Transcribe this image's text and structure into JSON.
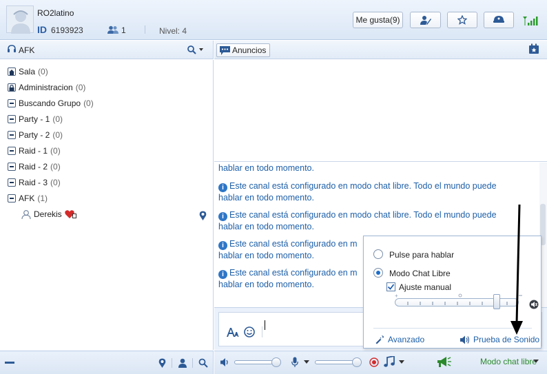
{
  "header": {
    "username": "RO2latino",
    "id_label": "ID",
    "id_value": "6193923",
    "friends_count": "1",
    "level": "Nivel: 4",
    "likes_button": "Me gusta(9)"
  },
  "left_panel": {
    "title": "AFK",
    "channels": [
      {
        "name": "Sala",
        "count": "(0)",
        "icon": "home-icon"
      },
      {
        "name": "Administracion",
        "count": "(0)",
        "icon": "lock-icon"
      },
      {
        "name": "Buscando Grupo",
        "count": "(0)",
        "icon": "collapse-icon"
      },
      {
        "name": "Party - 1",
        "count": "(0)",
        "icon": "collapse-icon"
      },
      {
        "name": "Party - 2",
        "count": "(0)",
        "icon": "collapse-icon"
      },
      {
        "name": "Raid - 1",
        "count": "(0)",
        "icon": "collapse-icon"
      },
      {
        "name": "Raid - 2",
        "count": "(0)",
        "icon": "collapse-icon"
      },
      {
        "name": "Raid - 3",
        "count": "(0)",
        "icon": "collapse-icon"
      },
      {
        "name": "AFK",
        "count": "(1)",
        "icon": "collapse-icon"
      }
    ],
    "user": "Derekis"
  },
  "right_panel": {
    "announce_button": "Anuncios",
    "partial_message": "hablar en todo momento.",
    "messages": [
      {
        "line1": "Este canal está configurado en modo chat libre. Todo el mundo puede",
        "line2": "hablar en todo momento."
      },
      {
        "line1": "Este canal está configurado en modo chat libre. Todo el mundo puede",
        "line2": "hablar en todo momento."
      },
      {
        "line1": "Este canal está configurado en m",
        "line2": "hablar en todo momento."
      },
      {
        "line1": "Este canal está configurado en m",
        "line2": "hablar en todo momento."
      }
    ]
  },
  "popup": {
    "push_to_talk": "Pulse para hablar",
    "free_chat_mode": "Modo Chat Libre",
    "manual_adjust": "Ajuste manual",
    "advanced": "Avanzado",
    "sound_test": "Prueba de Sonido"
  },
  "bottom_bar": {
    "mode": "Modo chat libre"
  },
  "colors": {
    "accent": "#1d5fa8",
    "mode_green": "#2b8a2b"
  }
}
